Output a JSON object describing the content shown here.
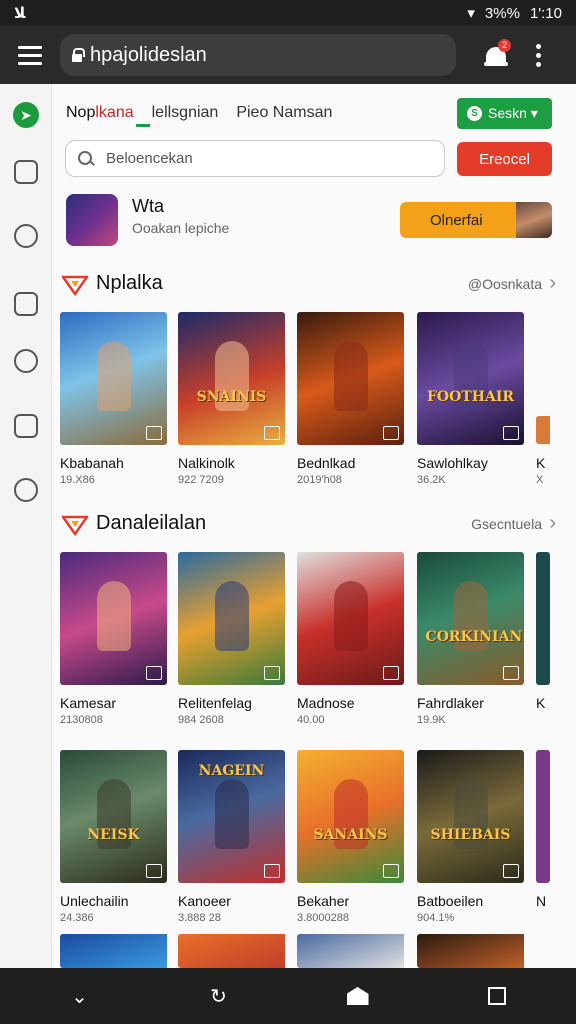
{
  "status_bar": {
    "left": "ﻼ",
    "battery": "3%%",
    "time": "1':10"
  },
  "browser": {
    "url": "hpajolideslan",
    "notification_count": "2"
  },
  "tabs": [
    {
      "prefix": "Nop",
      "accent": "lkana"
    },
    {
      "label": "lellsgnian"
    },
    {
      "label": "Pieo Namsan"
    }
  ],
  "green_button": {
    "label": "Seskn ▾"
  },
  "search": {
    "placeholder": "Beloencekan"
  },
  "red_button": {
    "label": "Ereocel"
  },
  "profile": {
    "title": "Wta",
    "subtitle": "Ooakan lepiche",
    "button_label": "Olnerfai"
  },
  "sections": [
    {
      "title": "Nplalka",
      "more": "@Oosnkata"
    },
    {
      "title": "Danaleilalan",
      "more": "Gsecntuela"
    }
  ],
  "row1": [
    {
      "name": "Kbabanah",
      "count": "19.X86"
    },
    {
      "name": "Nalkinolk",
      "count": "922 7209"
    },
    {
      "name": "Bednlkad",
      "count": "2019'h08"
    },
    {
      "name": "Sawlohlkay",
      "count": "36.2K"
    },
    {
      "name": "K",
      "count": "X"
    }
  ],
  "row2": [
    {
      "name": "Kamesar",
      "count": "2130808"
    },
    {
      "name": "Relitenfelag",
      "count": "984 2608"
    },
    {
      "name": "Madnose",
      "count": "40.00"
    },
    {
      "name": "Fahrdlaker",
      "count": "19.9K"
    },
    {
      "name": "K",
      "count": ""
    }
  ],
  "row3": [
    {
      "name": "Unlechailin",
      "count": "24.386"
    },
    {
      "name": "Kanoeer",
      "count": "3.888 28"
    },
    {
      "name": "Bekaher",
      "count": "3.8000288"
    },
    {
      "name": "Batboeilen",
      "count": "904.1%"
    },
    {
      "name": "N",
      "count": ""
    }
  ],
  "logos": {
    "r1c2": "SNAINIS",
    "r1c4": "FOOTHAIR",
    "r2c4": "CORKINIAN",
    "r3c1": "NEISK",
    "r3c2": "NAGEIN",
    "r3c3": "SANAINS",
    "r3c4": "SHIEBAIS"
  },
  "colors": {
    "green": "#1e9e42",
    "red": "#e53b2a",
    "orange": "#f4a11a"
  },
  "icons": [
    "hamburger-icon",
    "lock-icon",
    "bell-icon",
    "kebab-icon",
    "search-icon"
  ]
}
